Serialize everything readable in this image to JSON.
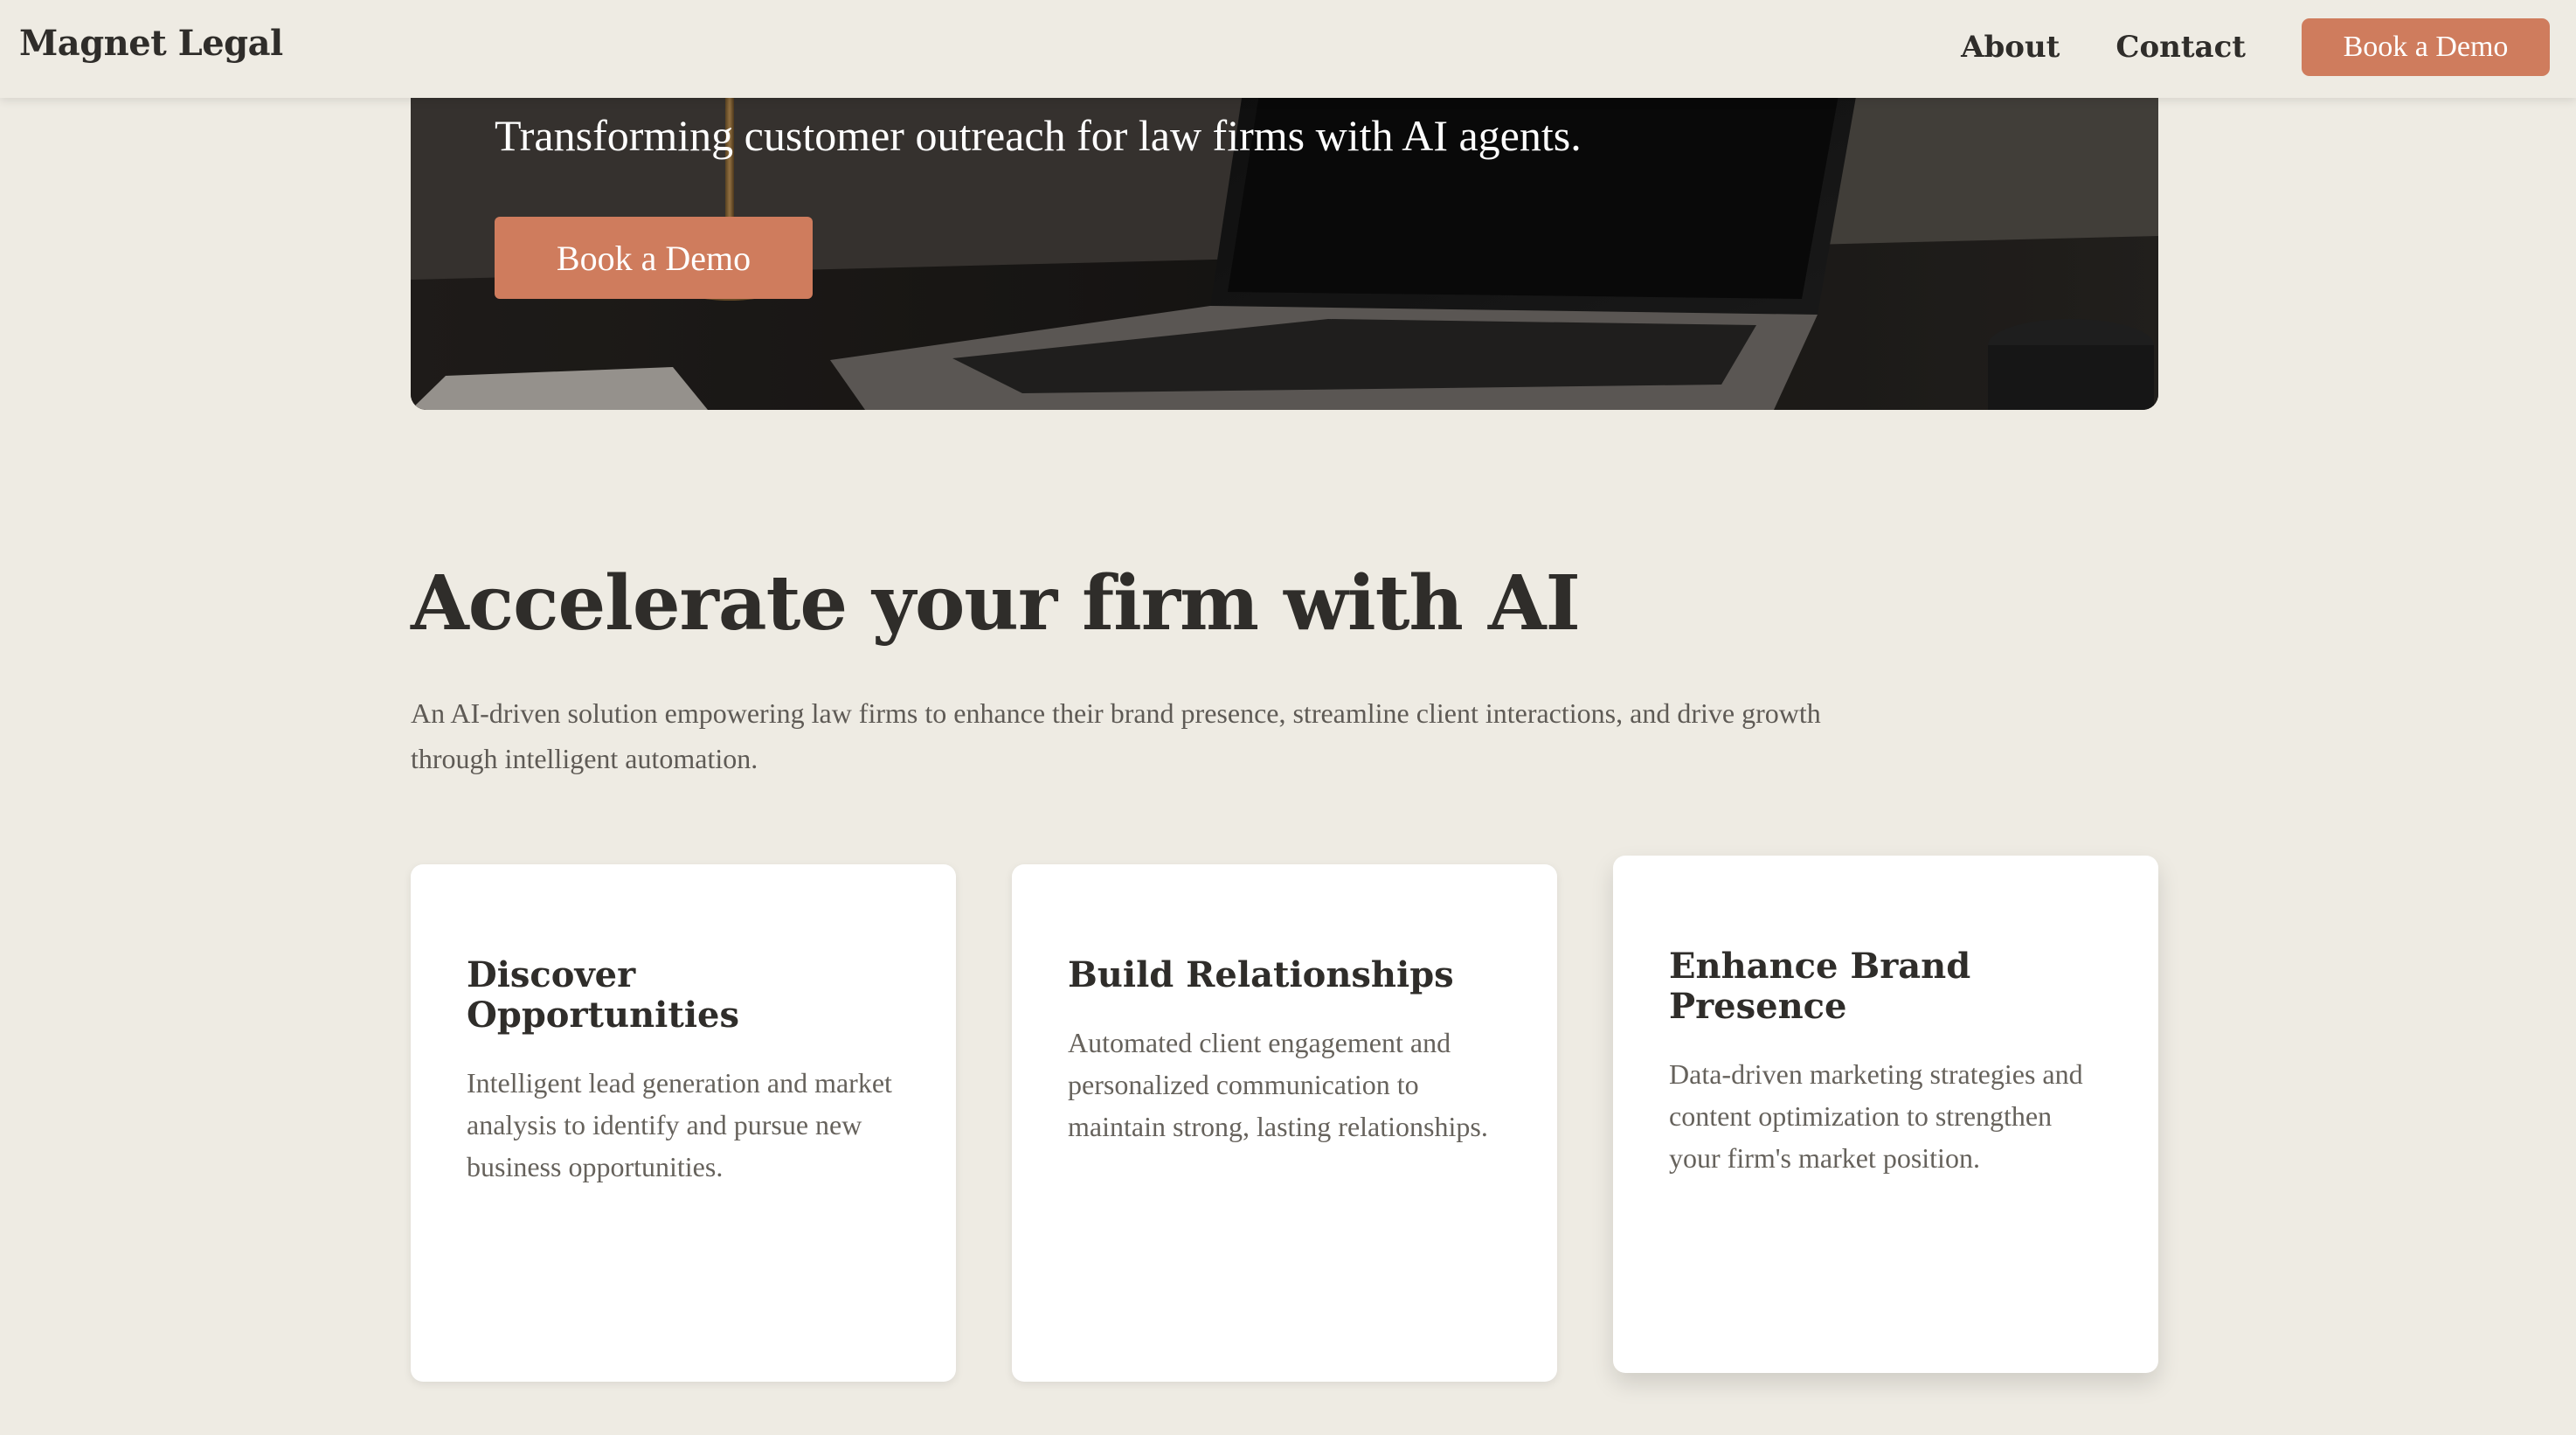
{
  "header": {
    "brand": "Magnet Legal",
    "nav": {
      "about": "About",
      "contact": "Contact"
    },
    "cta_label": "Book a Demo"
  },
  "hero": {
    "tagline": "Transforming customer outreach for law firms with AI agents.",
    "cta_label": "Book a Demo"
  },
  "features": {
    "title": "Accelerate your firm with AI",
    "description": "An AI-driven solution empowering law firms to enhance their brand presence, streamline client interactions, and drive growth through intelligent automation.",
    "cards": [
      {
        "title": "Discover Opportunities",
        "text": "Intelligent lead generation and market analysis to identify and pursue new business opportunities."
      },
      {
        "title": "Build Relationships",
        "text": "Automated client engagement and personalized communication to maintain strong, lasting relationships."
      },
      {
        "title": "Enhance Brand Presence",
        "text": "Data-driven marketing strategies and content optimization to strengthen your firm's market position."
      }
    ]
  },
  "colors": {
    "background": "#eeebe3",
    "accent": "#cf7c5d",
    "text": "#2f2d2a",
    "muted_text": "#5e5a55",
    "card": "#ffffff"
  }
}
